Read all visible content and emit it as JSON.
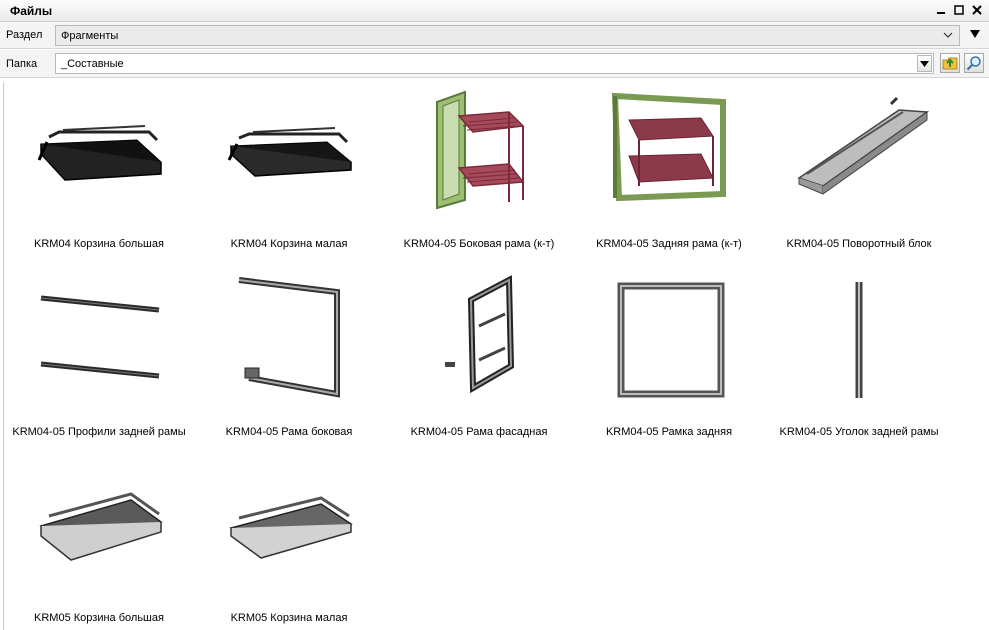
{
  "window": {
    "title": "Файлы"
  },
  "section": {
    "label": "Раздел",
    "value": "Фрагменты"
  },
  "folder": {
    "label": "Папка",
    "value": "_Составные"
  },
  "files": [
    {
      "name": "KRM04 Корзина большая",
      "icon": "basket-large-dark"
    },
    {
      "name": "KRM04 Корзина малая",
      "icon": "basket-small-dark"
    },
    {
      "name": "KRM04-05 Боковая рама (к-т)",
      "icon": "side-frame-set"
    },
    {
      "name": "KRM04-05 Задняя рама (к-т)",
      "icon": "back-frame-set"
    },
    {
      "name": "KRM04-05 Поворотный блок",
      "icon": "rotary-block"
    },
    {
      "name": "KRM04-05 Профили задней рамы",
      "icon": "back-frame-profiles"
    },
    {
      "name": "KRM04-05 Рама боковая",
      "icon": "side-frame"
    },
    {
      "name": "KRM04-05 Рама фасадная",
      "icon": "facade-frame"
    },
    {
      "name": "KRM04-05 Рамка задняя",
      "icon": "back-frame"
    },
    {
      "name": "KRM04-05 Уголок задней рамы",
      "icon": "back-frame-corner"
    },
    {
      "name": "KRM05 Корзина большая",
      "icon": "basket-large-grey"
    },
    {
      "name": "KRM05 Корзина малая",
      "icon": "basket-small-grey"
    }
  ],
  "colors": {
    "frame_green": "#7a9a52",
    "basket_red": "#8c3a4a",
    "metal_grey": "#8a8a8a"
  }
}
